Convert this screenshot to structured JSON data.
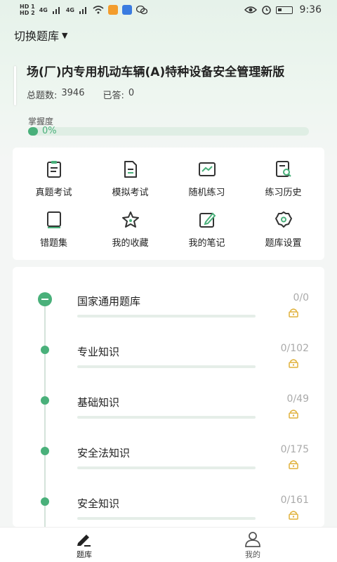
{
  "status_bar": {
    "left_chips": [
      "HD 1",
      "HD 2",
      "4G",
      "4G"
    ],
    "time": "9:36",
    "icons": [
      "wifi-icon",
      "app-icon",
      "app-icon",
      "wechat-icon",
      "eye-icon",
      "alarm-icon",
      "battery-icon"
    ]
  },
  "header": {
    "switch_label": "切换题库",
    "bank_title": "场(厂)内专用机动车辆(A)特种设备安全管理新版",
    "total_label": "总题数:",
    "total_value": "3946",
    "answered_label": "已答:",
    "answered_value": "0"
  },
  "mastery": {
    "label": "掌握度",
    "percent_text": "0%",
    "value": 0
  },
  "tools": [
    {
      "label": "真题考试",
      "icon": "clipboard-icon"
    },
    {
      "label": "模拟考试",
      "icon": "document-icon"
    },
    {
      "label": "随机练习",
      "icon": "chart-line-icon"
    },
    {
      "label": "练习历史",
      "icon": "history-search-icon"
    },
    {
      "label": "错题集",
      "icon": "book-icon"
    },
    {
      "label": "我的收藏",
      "icon": "star-icon"
    },
    {
      "label": "我的笔记",
      "icon": "edit-icon"
    },
    {
      "label": "题库设置",
      "icon": "gear-icon"
    }
  ],
  "chapters": [
    {
      "title": "国家通用题库",
      "count": "0/0"
    },
    {
      "title": "专业知识",
      "count": "0/102"
    },
    {
      "title": "基础知识",
      "count": "0/49"
    },
    {
      "title": "安全法知识",
      "count": "0/175"
    },
    {
      "title": "安全知识",
      "count": "0/161"
    }
  ],
  "tabbar": {
    "tabs": [
      {
        "label": "题库",
        "icon": "pen-icon",
        "active": true
      },
      {
        "label": "我的",
        "icon": "user-icon",
        "active": false
      }
    ]
  },
  "colors": {
    "accent": "#49b07a",
    "lock": "#e0b13a"
  }
}
